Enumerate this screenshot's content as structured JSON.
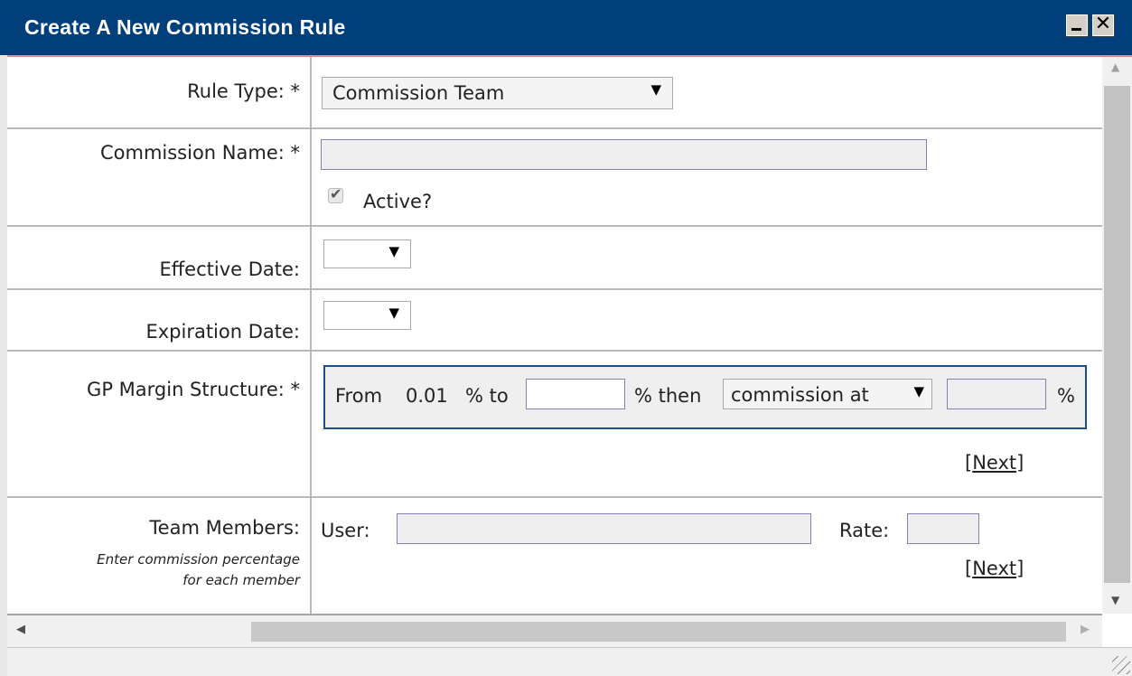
{
  "window": {
    "title": "Create A New Commission Rule",
    "minimize_icon": "minimize-icon",
    "close_icon": "close-icon",
    "close_glyph": "✕"
  },
  "form": {
    "rule_type": {
      "label": "Rule Type: *",
      "value": "Commission Team"
    },
    "commission_name": {
      "label": "Commission Name: *",
      "value": ""
    },
    "active": {
      "label": "Active?",
      "checked": true
    },
    "effective_date": {
      "label": "Effective Date:",
      "value": ""
    },
    "expiration_date": {
      "label": "Expiration Date:",
      "value": ""
    },
    "gp_margin": {
      "label": "GP Margin Structure: *",
      "from_text": "From",
      "from_value": "0.01",
      "to_text": "% to",
      "to_value": "",
      "then_text": "% then",
      "mode_value": "commission at",
      "rate_value": "",
      "percent_text": "%",
      "next_link": "Next"
    },
    "team_members": {
      "label": "Team Members:",
      "hint_line1": "Enter commission percentage",
      "hint_line2": "for each member",
      "user_label": "User:",
      "user_value": "",
      "rate_label": "Rate:",
      "rate_value": "",
      "next_link": "Next"
    }
  },
  "glyphs": {
    "dropdown_arrow": "▼",
    "bracket_open": "[",
    "bracket_close": "]",
    "check": "✔",
    "scroll_up": "▲",
    "scroll_down": "▼",
    "scroll_left": "◀",
    "scroll_right": "▶"
  },
  "colors": {
    "titlebar": "#003f79",
    "input_border": "#8a7fb0",
    "group_border": "#1d4e84"
  }
}
